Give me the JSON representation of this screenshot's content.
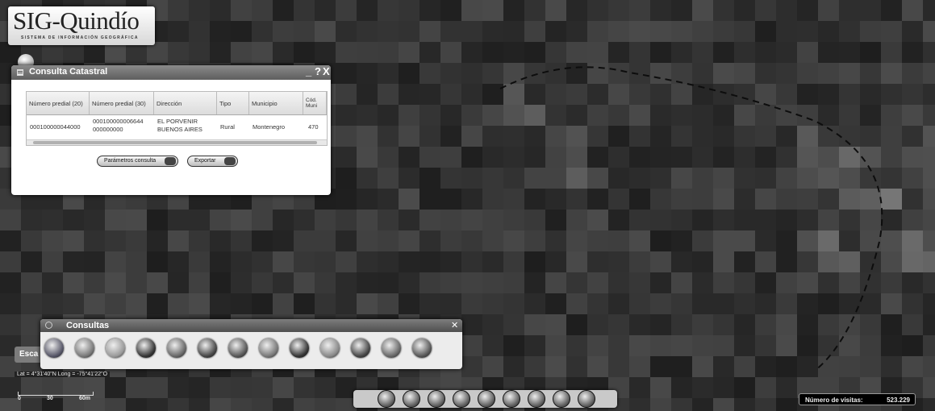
{
  "logo": {
    "title": "SIG-Quindío",
    "subtitle": "SISTEMA DE INFORMACIÓN GEOGRÁFICA"
  },
  "consulta_window": {
    "title": "Consulta Catastral",
    "minimize": "_",
    "help": "?",
    "close": "X",
    "table": {
      "columns": [
        "Número predial (20)",
        "Número predial (30)",
        "Dirección",
        "Tipo",
        "Municipio",
        "Cód. Muni"
      ],
      "rows": [
        {
          "numero_predial_20": "000100000044000",
          "numero_predial_30": "000100000006644 000000000",
          "direccion": "EL PORVENIR BUENOS AIRES",
          "tipo": "Rural",
          "municipio": "Montenegro",
          "cod_muni": "470"
        }
      ]
    },
    "buttons": {
      "parametros": "Parámetros consulta",
      "exportar": "Exportar"
    }
  },
  "consultas_panel": {
    "title": "Consultas",
    "close": "✕",
    "tools": [
      "consulta-tool-1-icon",
      "consulta-tool-2-icon",
      "consulta-tool-3-icon",
      "consulta-tool-4-icon",
      "consulta-tool-5-icon",
      "consulta-tool-6-icon",
      "consulta-tool-7-icon",
      "consulta-tool-8-icon",
      "consulta-tool-9-icon",
      "consulta-tool-10-icon",
      "consulta-tool-11-icon",
      "consulta-tool-12-icon",
      "consulta-tool-13-icon"
    ]
  },
  "map": {
    "escala_label": "Esca",
    "coordinates": "Lat = 4°31'40\"N Long = -75°41'22\"O",
    "scale_labels": [
      "0",
      "30",
      "60m"
    ]
  },
  "bottom_toolbar": {
    "tools": [
      "pan-icon",
      "zoom-in-icon",
      "globe-icon",
      "home-icon",
      "layers-icon",
      "print-icon",
      "info-icon",
      "measure-icon",
      "settings-icon"
    ]
  },
  "visitas": {
    "label": "Número de visitas:",
    "count": "523.229"
  },
  "colors": {
    "window_bar": "#6a6a6a",
    "map_background": "#2a2a2a",
    "boundary_line": "#1a1a1a"
  }
}
